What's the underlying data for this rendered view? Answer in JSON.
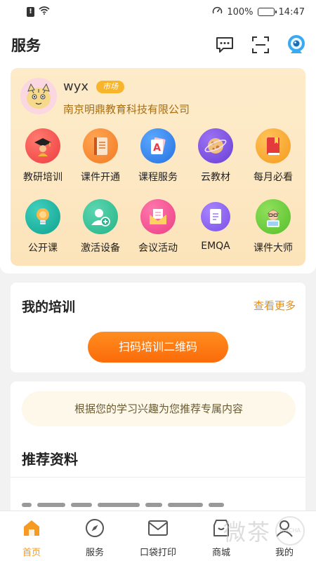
{
  "status_bar": {
    "time": "14:47",
    "battery": "100%"
  },
  "header": {
    "title": "服务"
  },
  "profile": {
    "username": "wyx",
    "badge": "市场",
    "company": "南京明鼎教育科技有限公司"
  },
  "services": [
    {
      "label": "教研培训",
      "icon": "graduate-icon",
      "color": "#f24f4a"
    },
    {
      "label": "课件开通",
      "icon": "courseware-book-icon",
      "color": "#f5862a"
    },
    {
      "label": "课程服务",
      "icon": "letter-a-card-icon",
      "color": "#2f80ea"
    },
    {
      "label": "云教材",
      "icon": "planet-icon",
      "color": "#7c4fe0"
    },
    {
      "label": "每月必看",
      "icon": "red-book-icon",
      "color": "#f8a42c"
    },
    {
      "label": "公开课",
      "icon": "light-bulb-icon",
      "color": "#19b5a3"
    },
    {
      "label": "激活设备",
      "icon": "add-user-icon",
      "color": "#2dbb92"
    },
    {
      "label": "会议活动",
      "icon": "envelope-icon",
      "color": "#f24d8e"
    },
    {
      "label": "EMQA",
      "icon": "document-icon",
      "color": "#8a62ea"
    },
    {
      "label": "课件大师",
      "icon": "teacher-avatar-icon",
      "color": "#6fcf3b"
    }
  ],
  "training": {
    "title": "我的培训",
    "more": "查看更多",
    "scan_button": "扫码培训二维码"
  },
  "recommend": {
    "notice": "根据您的学习兴趣为您推荐专属内容",
    "title": "推荐资料"
  },
  "tabs": [
    {
      "label": "首页",
      "icon": "home-icon",
      "active": true
    },
    {
      "label": "服务",
      "icon": "compass-icon",
      "active": false
    },
    {
      "label": "口袋打印",
      "icon": "print-envelope-icon",
      "active": false
    },
    {
      "label": "商城",
      "icon": "shop-icon",
      "active": false
    },
    {
      "label": "我的",
      "icon": "user-icon",
      "active": false
    }
  ],
  "watermark": {
    "text": "微茶",
    "logo_text": "WXCHA"
  },
  "colors": {
    "accent": "#f59a23",
    "brand_orange": "#fb6b0a",
    "company_text": "#a86d10"
  }
}
